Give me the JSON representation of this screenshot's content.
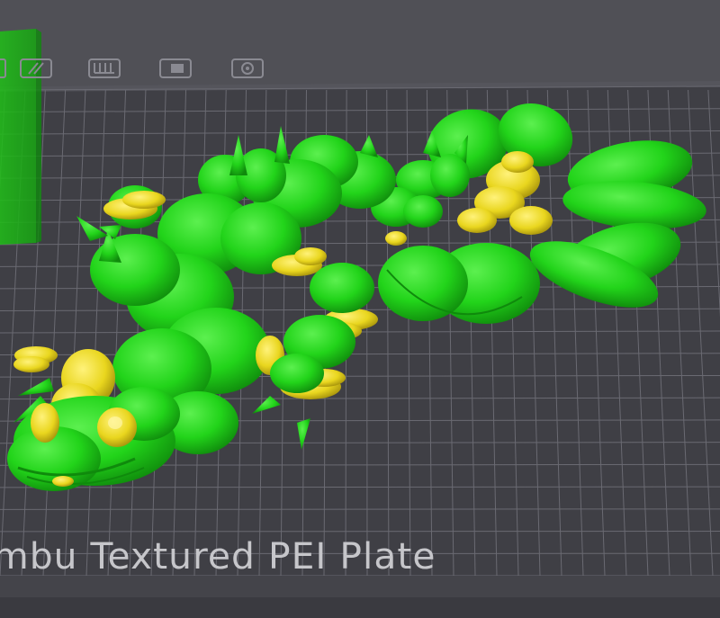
{
  "plate": {
    "name": "mbu Textured PEI Plate"
  },
  "colors": {
    "background": "#505056",
    "plate_surface": "#3f3f45",
    "grid_line": "#6a6a72",
    "model_green": "#22d41a",
    "model_yellow": "#e9d61e",
    "selection_box": "#1fbf17"
  },
  "toolbar": {
    "icons": [
      "arrange-icon",
      "split-icon",
      "layers-icon",
      "cut-icon",
      "settings-icon"
    ]
  }
}
